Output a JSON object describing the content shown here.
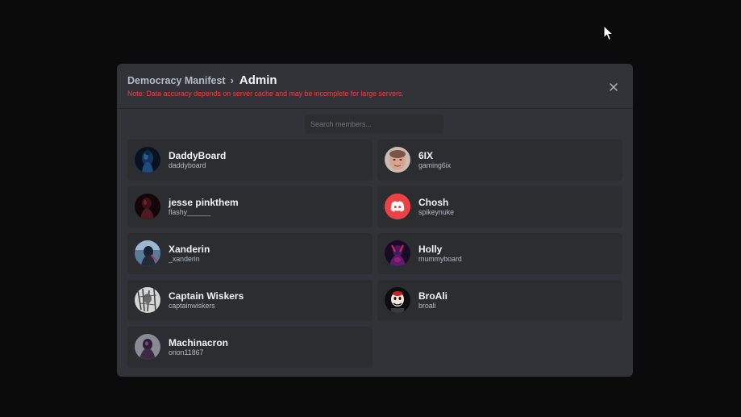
{
  "header": {
    "server_name": "Democracy Manifest",
    "separator": "›",
    "role_name": "Admin",
    "note": "Note: Data accuracy depends on server cache and may be incomplete for large servers."
  },
  "search": {
    "placeholder": "Search members..."
  },
  "members": [
    {
      "name": "DaddyBoard",
      "username": "daddyboard",
      "avatar": "dark-blue-figure"
    },
    {
      "name": "6IX",
      "username": "gaming6ix",
      "avatar": "face-photo"
    },
    {
      "name": "jesse pinkthem",
      "username": "flashy______",
      "avatar": "dark-red-figure"
    },
    {
      "name": "Chosh",
      "username": "spikeynuke",
      "avatar": "discord-logo-red"
    },
    {
      "name": "Xanderin",
      "username": "_xanderin",
      "avatar": "blue-figure"
    },
    {
      "name": "Holly",
      "username": "mummyboard",
      "avatar": "purple-figure"
    },
    {
      "name": "Captain Wiskers",
      "username": "captainwiskers",
      "avatar": "grey-sketch"
    },
    {
      "name": "BroAli",
      "username": "broali",
      "avatar": "cartoon-character"
    },
    {
      "name": "Machinacron",
      "username": "orion11867",
      "avatar": "dark-purple-figure"
    }
  ],
  "colors": {
    "modal_bg": "#313338",
    "card_bg": "#2b2d31",
    "note_red": "#f23f43",
    "discord_red": "#ed4245"
  }
}
